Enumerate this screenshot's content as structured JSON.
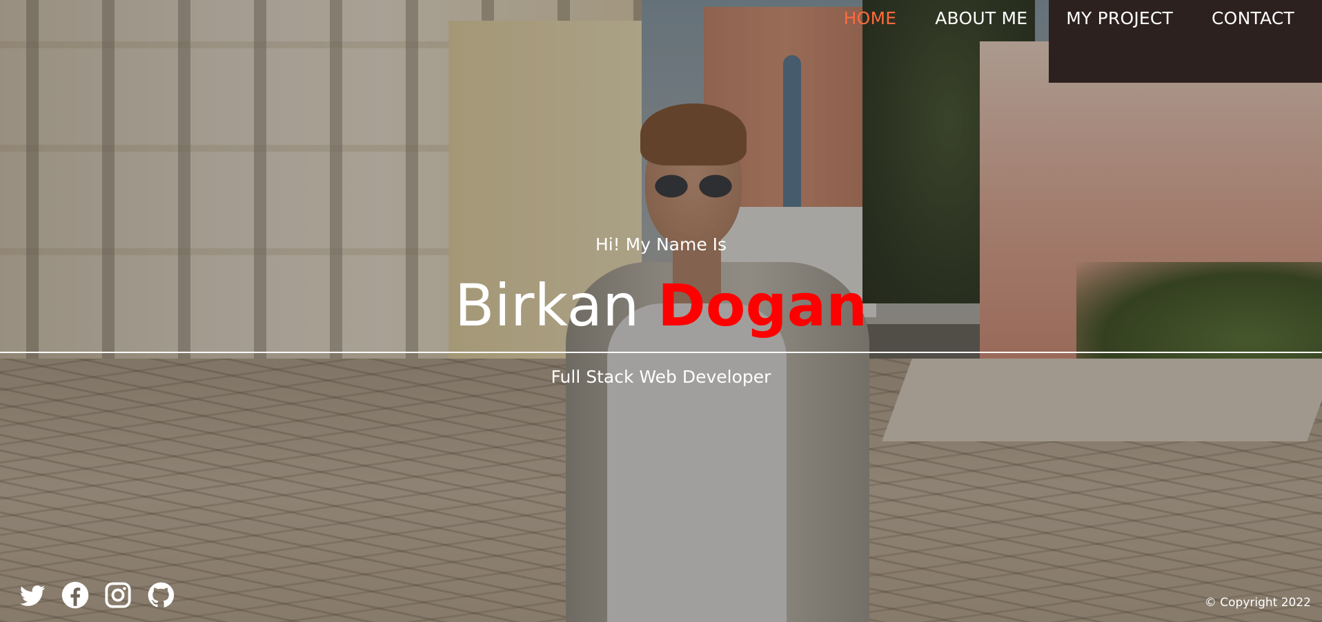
{
  "nav": {
    "items": [
      {
        "label": "HOME",
        "active": true
      },
      {
        "label": "ABOUT ME",
        "active": false
      },
      {
        "label": "MY PROJECT",
        "active": false
      },
      {
        "label": "CONTACT",
        "active": false
      }
    ],
    "active_color": "#ff6a3d"
  },
  "hero": {
    "greeting": "Hi! My Name Is",
    "first_name": "Birkan",
    "last_name": "Dogan",
    "role": "Full Stack Web Developer",
    "last_name_color": "#ff0000"
  },
  "socials": [
    {
      "icon": "twitter-icon"
    },
    {
      "icon": "facebook-icon"
    },
    {
      "icon": "instagram-icon"
    },
    {
      "icon": "github-icon"
    }
  ],
  "footer": {
    "copyright": "© Copyright 2022"
  }
}
